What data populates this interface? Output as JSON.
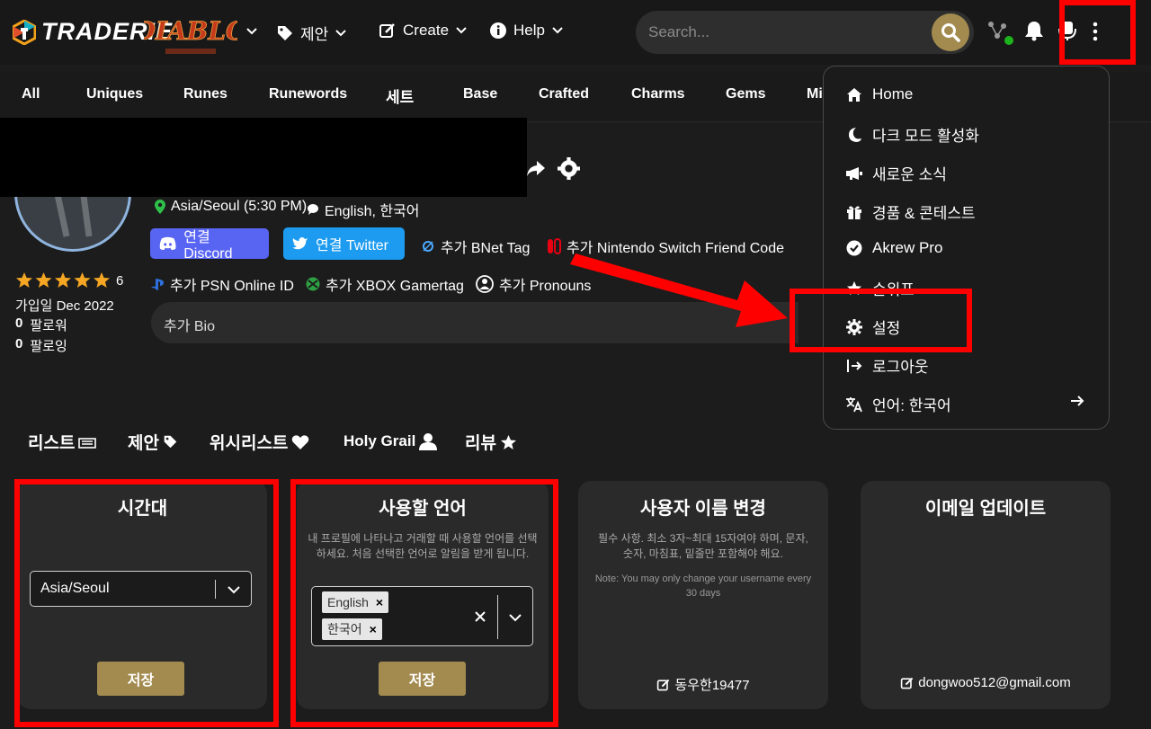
{
  "header": {
    "logo_text": "TRADERIE",
    "nav": [
      {
        "label": "제안"
      },
      {
        "label": "Create"
      },
      {
        "label": "Help"
      }
    ],
    "search_placeholder": "Search..."
  },
  "categories": [
    "All",
    "Uniques",
    "Runes",
    "Runewords",
    "세트",
    "Base",
    "Crafted",
    "Charms",
    "Gems",
    "Mi"
  ],
  "profile": {
    "timezone_display": "Asia/Seoul (5:30 PM)",
    "languages_display": "English, 한국어",
    "discord_label": "연결 Discord",
    "twitter_label": "연결 Twitter",
    "bnet_label": "추가 BNet Tag",
    "nintendo_label": "추가 Nintendo Switch Friend Code",
    "psn_label": "추가 PSN Online ID",
    "xbox_label": "추가 XBOX Gamertag",
    "pronouns_label": "추가 Pronouns",
    "bio_label": "추가 Bio",
    "rating_count": "6",
    "rating_stars": 5,
    "joined": "가입일 Dec 2022",
    "followers_count": "0",
    "followers_label": "팔로워",
    "following_count": "0",
    "following_label": "팔로잉"
  },
  "menu": {
    "items": [
      {
        "label": "Home",
        "icon": "home-icon"
      },
      {
        "label": "다크 모드 활성화",
        "icon": "moon-icon"
      },
      {
        "label": "새로운 소식",
        "icon": "megaphone-icon"
      },
      {
        "label": "경품 & 콘테스트",
        "icon": "gift-icon"
      },
      {
        "label": "Akrew Pro",
        "icon": "check-badge-icon"
      },
      {
        "label": "순위표",
        "icon": "star-icon"
      },
      {
        "label": "설정",
        "icon": "gear-icon"
      },
      {
        "label": "로그아웃",
        "icon": "logout-icon"
      },
      {
        "label": "언어: 한국어",
        "icon": "translate-icon"
      }
    ]
  },
  "tabs": [
    {
      "label": "리스트",
      "icon": "list-icon"
    },
    {
      "label": "제안",
      "icon": "tag-icon"
    },
    {
      "label": "위시리스트",
      "icon": "heart-icon"
    },
    {
      "label": "Holy Grail",
      "icon": "user-icon"
    },
    {
      "label": "리뷰",
      "icon": "star-icon"
    }
  ],
  "cards": {
    "timezone": {
      "title": "시간대",
      "value": "Asia/Seoul",
      "save_label": "저장"
    },
    "language": {
      "title": "사용할 언어",
      "desc": "내 프로필에 나타나고 거래할 때 사용할 언어를 선택하세요. 처음 선택한 언어로 알림을 받게 됩니다.",
      "chips": [
        "English",
        "한국어"
      ],
      "save_label": "저장"
    },
    "username": {
      "title": "사용자 이름 변경",
      "desc": "필수 사항. 최소 3자~최대 15자여야 하며, 문자, 숫자, 마침표, 밑줄만 포함해야 해요.",
      "note": "Note: You may only change your username every 30 days",
      "value": "동우한19477"
    },
    "email": {
      "title": "이메일 업데이트",
      "value": "dongwoo512@gmail.com"
    }
  },
  "colors": {
    "accent_gold": "#a38b4f",
    "annotation_red": "#ff0000",
    "discord": "#5865f2",
    "twitter": "#1d9bf0"
  }
}
